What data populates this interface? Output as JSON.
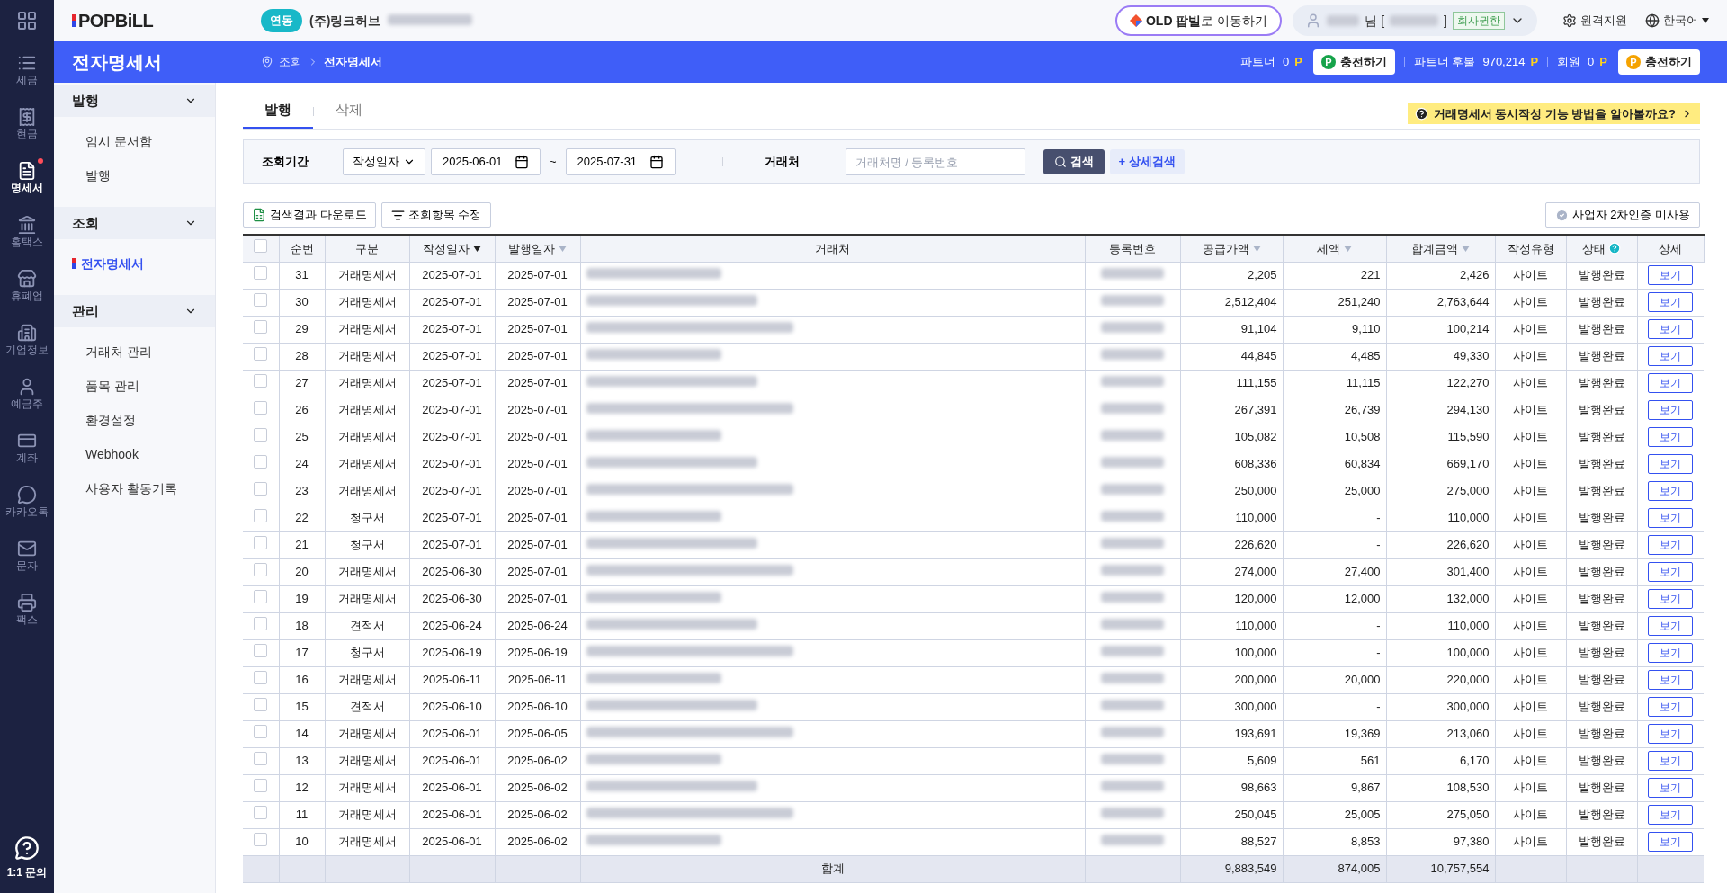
{
  "rail": {
    "items": [
      {
        "label": "세금",
        "selected": false,
        "dot": false
      },
      {
        "label": "현금",
        "selected": false,
        "dot": false
      },
      {
        "label": "명세서",
        "selected": true,
        "dot": true
      },
      {
        "label": "홈택스",
        "selected": false,
        "dot": false
      },
      {
        "label": "휴폐업",
        "selected": false,
        "dot": false
      },
      {
        "label": "기업정보",
        "selected": false,
        "dot": false
      },
      {
        "label": "예금주",
        "selected": false,
        "dot": false
      },
      {
        "label": "계좌",
        "selected": false,
        "dot": false
      },
      {
        "label": "카카오톡",
        "selected": false,
        "dot": false
      },
      {
        "label": "문자",
        "selected": false,
        "dot": false
      },
      {
        "label": "팩스",
        "selected": false,
        "dot": false
      }
    ],
    "help": "1:1 문의"
  },
  "header": {
    "logo": "POPBiLL",
    "link_badge": "연동",
    "company": "(주)링크허브",
    "old_link": "**OLD 팝빌**로 이동하기",
    "user_suffix": "님 [",
    "user_close": "]",
    "role": "회사권한",
    "remote": "원격지원",
    "language": "한국어"
  },
  "title_bar": {
    "title": "전자명세서",
    "breadcrumb": [
      "조회",
      "전자명세서"
    ],
    "balances": [
      {
        "label": "파트너",
        "amount": "0",
        "unit": "P",
        "charge": {
          "badge": "P",
          "label": "충전하기",
          "color": "#16a34a"
        }
      },
      {
        "label": "파트너 후불",
        "amount": "970,214",
        "unit": "P"
      },
      {
        "label": "회원",
        "amount": "0",
        "unit": "P",
        "charge": {
          "badge": "P",
          "label": "충전하기",
          "color": "#f5a300"
        }
      }
    ]
  },
  "sidebar": {
    "groups": [
      {
        "label": "발행",
        "expanded": true,
        "items": [
          {
            "label": "임시 문서함",
            "selected": false
          },
          {
            "label": "발행",
            "selected": false
          }
        ]
      },
      {
        "label": "조회",
        "expanded": true,
        "items": [
          {
            "label": "전자명세서",
            "selected": true
          }
        ]
      },
      {
        "label": "관리",
        "expanded": true,
        "items": [
          {
            "label": "거래처 관리",
            "selected": false
          },
          {
            "label": "품목 관리",
            "selected": false
          },
          {
            "label": "환경설정",
            "selected": false
          },
          {
            "label": "Webhook",
            "selected": false
          },
          {
            "label": "사용자 활동기록",
            "selected": false
          }
        ]
      }
    ]
  },
  "tabs": [
    {
      "label": "발행",
      "selected": true
    },
    {
      "label": "삭제",
      "selected": false
    }
  ],
  "help_link": "거래명세서 동시작성 기능 방법을 알아볼까요?",
  "filter": {
    "period_label": "조회기간",
    "date_type": "작성일자",
    "from": "2025-06-01",
    "separator": "~",
    "to": "2025-07-31",
    "partner_label": "거래처",
    "partner_placeholder": "거래처명 / 등록번호",
    "search": "검색",
    "advanced": "+ 상세검색"
  },
  "actions": {
    "download": "검색결과 다운로드",
    "columns": "조회항목 수정",
    "auth": "사업자 2차인증 미사용"
  },
  "table": {
    "all_checked": false,
    "columns": [
      {
        "label": "순번"
      },
      {
        "label": "구분"
      },
      {
        "label": "작성일자",
        "sorted": true
      },
      {
        "label": "발행일자",
        "sorted": false
      },
      {
        "label": "거래처"
      },
      {
        "label": "등록번호"
      },
      {
        "label": "공급가액",
        "sorted": false
      },
      {
        "label": "세액",
        "sorted": false
      },
      {
        "label": "합계금액",
        "sorted": false
      },
      {
        "label": "작성유형"
      },
      {
        "label": "상태",
        "info": true
      },
      {
        "label": "상세"
      }
    ],
    "rows": [
      {
        "checked": false,
        "no": "31",
        "type": "거래명세서",
        "written": "2025-07-01",
        "issued": "2025-07-01",
        "supply": "2,205",
        "tax": "221",
        "total": "2,426",
        "method": "사이트",
        "status": "발행완료",
        "action": "보기"
      },
      {
        "checked": false,
        "no": "30",
        "type": "거래명세서",
        "written": "2025-07-01",
        "issued": "2025-07-01",
        "supply": "2,512,404",
        "tax": "251,240",
        "total": "2,763,644",
        "method": "사이트",
        "status": "발행완료",
        "action": "보기"
      },
      {
        "checked": false,
        "no": "29",
        "type": "거래명세서",
        "written": "2025-07-01",
        "issued": "2025-07-01",
        "supply": "91,104",
        "tax": "9,110",
        "total": "100,214",
        "method": "사이트",
        "status": "발행완료",
        "action": "보기"
      },
      {
        "checked": false,
        "no": "28",
        "type": "거래명세서",
        "written": "2025-07-01",
        "issued": "2025-07-01",
        "supply": "44,845",
        "tax": "4,485",
        "total": "49,330",
        "method": "사이트",
        "status": "발행완료",
        "action": "보기"
      },
      {
        "checked": false,
        "no": "27",
        "type": "거래명세서",
        "written": "2025-07-01",
        "issued": "2025-07-01",
        "supply": "111,155",
        "tax": "11,115",
        "total": "122,270",
        "method": "사이트",
        "status": "발행완료",
        "action": "보기"
      },
      {
        "checked": false,
        "no": "26",
        "type": "거래명세서",
        "written": "2025-07-01",
        "issued": "2025-07-01",
        "supply": "267,391",
        "tax": "26,739",
        "total": "294,130",
        "method": "사이트",
        "status": "발행완료",
        "action": "보기"
      },
      {
        "checked": false,
        "no": "25",
        "type": "거래명세서",
        "written": "2025-07-01",
        "issued": "2025-07-01",
        "supply": "105,082",
        "tax": "10,508",
        "total": "115,590",
        "method": "사이트",
        "status": "발행완료",
        "action": "보기"
      },
      {
        "checked": false,
        "no": "24",
        "type": "거래명세서",
        "written": "2025-07-01",
        "issued": "2025-07-01",
        "supply": "608,336",
        "tax": "60,834",
        "total": "669,170",
        "method": "사이트",
        "status": "발행완료",
        "action": "보기"
      },
      {
        "checked": false,
        "no": "23",
        "type": "거래명세서",
        "written": "2025-07-01",
        "issued": "2025-07-01",
        "supply": "250,000",
        "tax": "25,000",
        "total": "275,000",
        "method": "사이트",
        "status": "발행완료",
        "action": "보기"
      },
      {
        "checked": false,
        "no": "22",
        "type": "청구서",
        "written": "2025-07-01",
        "issued": "2025-07-01",
        "supply": "110,000",
        "tax": "-",
        "total": "110,000",
        "method": "사이트",
        "status": "발행완료",
        "action": "보기"
      },
      {
        "checked": false,
        "no": "21",
        "type": "청구서",
        "written": "2025-07-01",
        "issued": "2025-07-01",
        "supply": "226,620",
        "tax": "-",
        "total": "226,620",
        "method": "사이트",
        "status": "발행완료",
        "action": "보기"
      },
      {
        "checked": false,
        "no": "20",
        "type": "거래명세서",
        "written": "2025-06-30",
        "issued": "2025-07-01",
        "supply": "274,000",
        "tax": "27,400",
        "total": "301,400",
        "method": "사이트",
        "status": "발행완료",
        "action": "보기"
      },
      {
        "checked": false,
        "no": "19",
        "type": "거래명세서",
        "written": "2025-06-30",
        "issued": "2025-07-01",
        "supply": "120,000",
        "tax": "12,000",
        "total": "132,000",
        "method": "사이트",
        "status": "발행완료",
        "action": "보기"
      },
      {
        "checked": false,
        "no": "18",
        "type": "견적서",
        "written": "2025-06-24",
        "issued": "2025-06-24",
        "supply": "110,000",
        "tax": "-",
        "total": "110,000",
        "method": "사이트",
        "status": "발행완료",
        "action": "보기"
      },
      {
        "checked": false,
        "no": "17",
        "type": "청구서",
        "written": "2025-06-19",
        "issued": "2025-06-19",
        "supply": "100,000",
        "tax": "-",
        "total": "100,000",
        "method": "사이트",
        "status": "발행완료",
        "action": "보기"
      },
      {
        "checked": false,
        "no": "16",
        "type": "거래명세서",
        "written": "2025-06-11",
        "issued": "2025-06-11",
        "supply": "200,000",
        "tax": "20,000",
        "total": "220,000",
        "method": "사이트",
        "status": "발행완료",
        "action": "보기"
      },
      {
        "checked": false,
        "no": "15",
        "type": "견적서",
        "written": "2025-06-10",
        "issued": "2025-06-10",
        "supply": "300,000",
        "tax": "-",
        "total": "300,000",
        "method": "사이트",
        "status": "발행완료",
        "action": "보기"
      },
      {
        "checked": false,
        "no": "14",
        "type": "거래명세서",
        "written": "2025-06-01",
        "issued": "2025-06-05",
        "supply": "193,691",
        "tax": "19,369",
        "total": "213,060",
        "method": "사이트",
        "status": "발행완료",
        "action": "보기"
      },
      {
        "checked": false,
        "no": "13",
        "type": "거래명세서",
        "written": "2025-06-01",
        "issued": "2025-06-02",
        "supply": "5,609",
        "tax": "561",
        "total": "6,170",
        "method": "사이트",
        "status": "발행완료",
        "action": "보기"
      },
      {
        "checked": false,
        "no": "12",
        "type": "거래명세서",
        "written": "2025-06-01",
        "issued": "2025-06-02",
        "supply": "98,663",
        "tax": "9,867",
        "total": "108,530",
        "method": "사이트",
        "status": "발행완료",
        "action": "보기"
      },
      {
        "checked": false,
        "no": "11",
        "type": "거래명세서",
        "written": "2025-06-01",
        "issued": "2025-06-02",
        "supply": "250,045",
        "tax": "25,005",
        "total": "275,050",
        "method": "사이트",
        "status": "발행완료",
        "action": "보기"
      },
      {
        "checked": false,
        "no": "10",
        "type": "거래명세서",
        "written": "2025-06-01",
        "issued": "2025-06-02",
        "supply": "88,527",
        "tax": "8,853",
        "total": "97,380",
        "method": "사이트",
        "status": "발행완료",
        "action": "보기"
      }
    ],
    "footer": {
      "label": "합계",
      "supply": "9,883,549",
      "tax": "874,005",
      "total": "10,757,554"
    }
  }
}
